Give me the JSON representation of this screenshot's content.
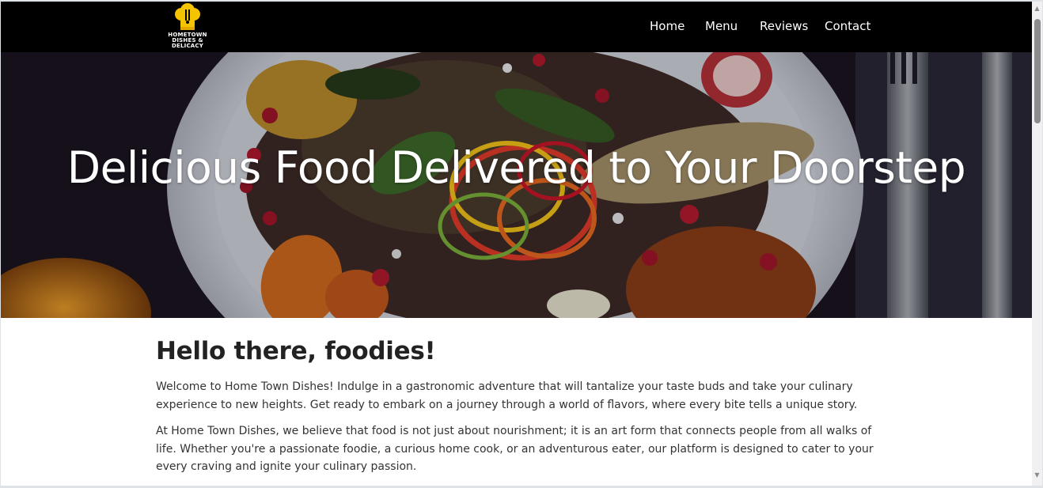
{
  "brand": {
    "logo_line1": "HOMETOWN",
    "logo_line2": "DISHES & DELICACY",
    "logo_icon": "chef-hat-icon",
    "accent_color": "#f5c400"
  },
  "nav": {
    "items": [
      {
        "label": "Home"
      },
      {
        "label": "Menu"
      },
      {
        "label": "Reviews"
      },
      {
        "label": "Contact"
      }
    ]
  },
  "hero": {
    "title": "Delicious Food Delivered to Your Doorstep",
    "image": "food-plate-image"
  },
  "main": {
    "heading": "Hello there, foodies!",
    "paragraphs": [
      "Welcome to Home Town Dishes! Indulge in a gastronomic adventure that will tantalize your taste buds and take your culinary experience to new heights. Get ready to embark on a journey through a world of flavors, where every bite tells a unique story.",
      "At Home Town Dishes, we believe that food is not just about nourishment; it is an art form that connects people from all walks of life. Whether you're a passionate foodie, a curious home cook, or an adventurous eater, our platform is designed to cater to your every craving and ignite your culinary passion."
    ]
  },
  "scrollbar": {
    "up_icon": "arrow-up-icon",
    "down_icon": "arrow-down-icon"
  }
}
